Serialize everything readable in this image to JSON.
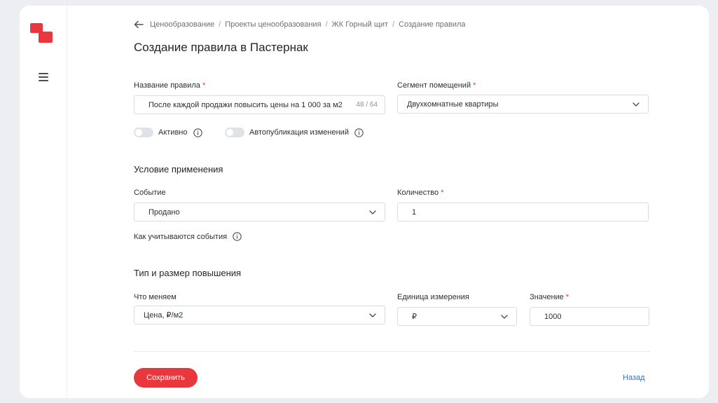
{
  "breadcrumb": {
    "items": [
      "Ценообразование",
      "Проекты ценообразования",
      "ЖК Горный щит",
      "Создание правила"
    ],
    "separator": "/"
  },
  "page": {
    "title": "Создание правила в Пастернак"
  },
  "rule_name": {
    "label": "Название правила",
    "required_mark": "*",
    "value": "После каждой продажи повысить цены на 1 000 за м2",
    "counter": "48 / 64"
  },
  "segment": {
    "label": "Сегмент помещений",
    "required_mark": "*",
    "value": "Двухкомнатные квартиры"
  },
  "toggles": {
    "active_label": "Активно",
    "autopublish_label": "Автопубликация изменений"
  },
  "condition": {
    "section_title": "Условие применения",
    "event_label": "Событие",
    "event_value": "Продано",
    "quantity_label": "Количество",
    "quantity_required": "*",
    "quantity_value": "1",
    "events_hint": "Как учитываются события"
  },
  "increase": {
    "section_title": "Тип и размер повышения",
    "what_label": "Что меняем",
    "what_value": "Цена, ₽/м2",
    "unit_label": "Единица измерения",
    "unit_value": "₽",
    "value_label": "Значение",
    "value_required": "*",
    "value_value": "1000"
  },
  "actions": {
    "save_label": "Сохранить",
    "back_label": "Назад"
  },
  "colors": {
    "accent": "#e8383d",
    "link": "#2f6fd6"
  }
}
